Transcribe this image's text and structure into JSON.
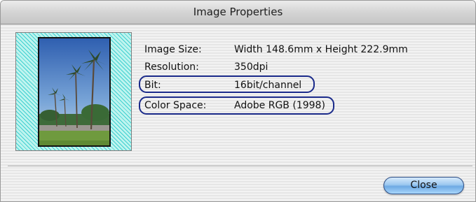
{
  "window": {
    "title": "Image Properties"
  },
  "thumbnail": {
    "icon": "photo-thumbnail"
  },
  "properties": [
    {
      "label": "Image Size:",
      "value": "Width 148.6mm x Height 222.9mm",
      "highlighted": false
    },
    {
      "label": "Resolution:",
      "value": "350dpi",
      "highlighted": false
    },
    {
      "label": "Bit:",
      "value": "16bit/channel",
      "highlighted": true
    },
    {
      "label": "Color Space:",
      "value": "Adobe RGB (1998)",
      "highlighted": true
    }
  ],
  "buttons": {
    "close_label": "Close"
  },
  "colors": {
    "highlight_outline": "#1a2a8a",
    "button_accent": "#6ea9e4"
  }
}
